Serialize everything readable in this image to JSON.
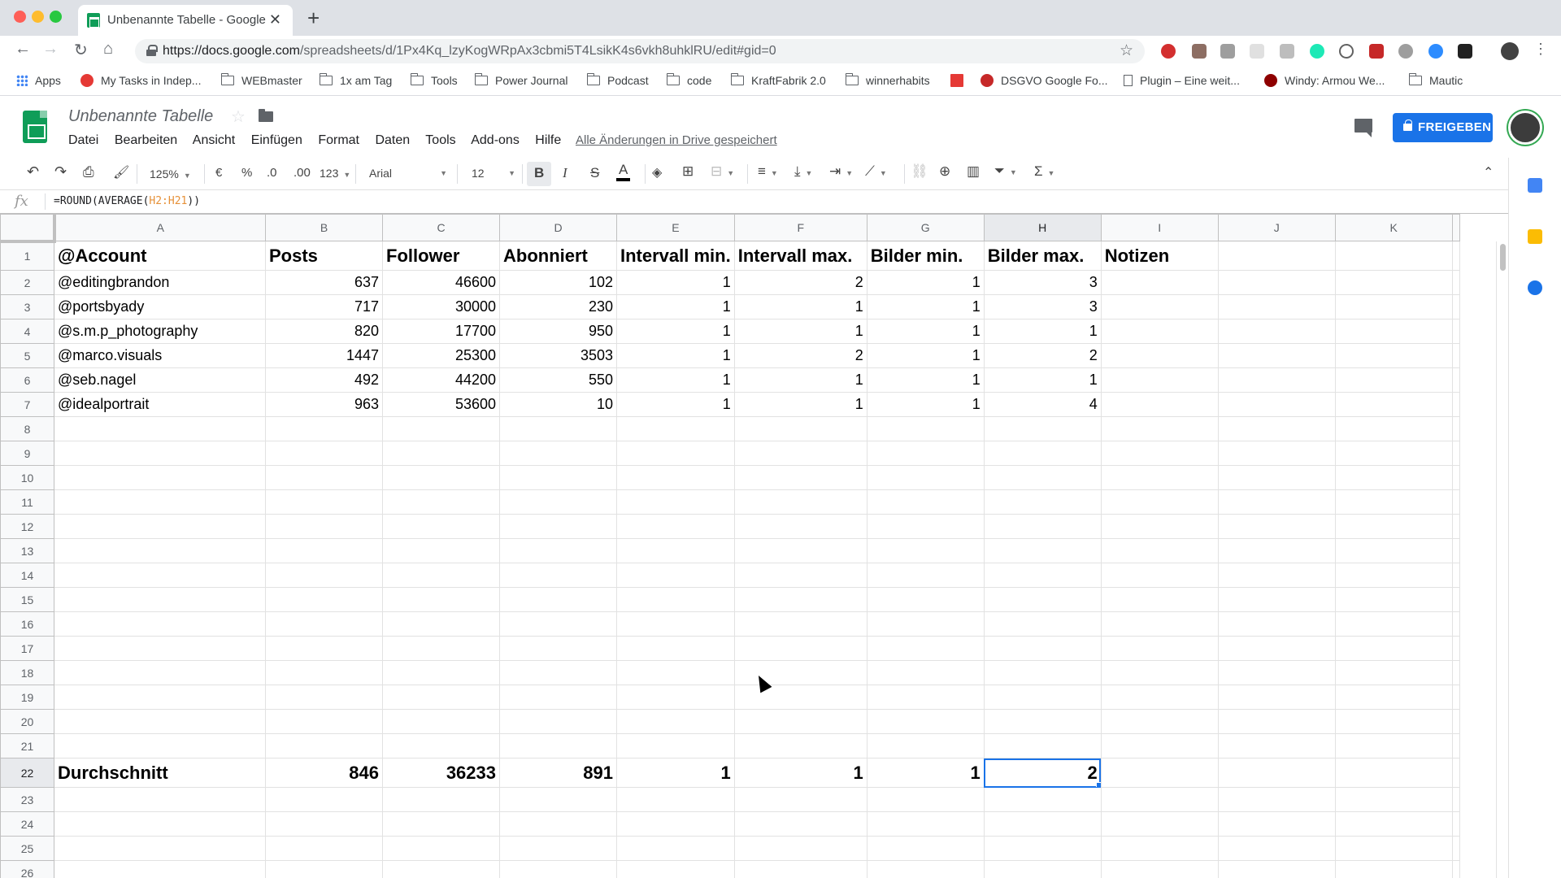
{
  "browser": {
    "tab_title": "Unbenannte Tabelle - Google T",
    "tab_close": "✕",
    "new_tab": "+",
    "url_host": "https://docs.google.com",
    "url_path": "/spreadsheets/d/1Px4Kq_lzyKogWRpAx3cbmi5T4LsikK4s6vkh8uhklRU/edit#gid=0",
    "bookmarks": [
      {
        "label": "Apps",
        "icon": "apps-grid-icon"
      },
      {
        "label": "My Tasks in Indep...",
        "icon": "tasks-icon"
      },
      {
        "label": "WEBmaster",
        "icon": "folder-icon"
      },
      {
        "label": "1x am Tag",
        "icon": "folder-icon"
      },
      {
        "label": "Tools",
        "icon": "folder-icon"
      },
      {
        "label": "Power Journal",
        "icon": "folder-icon"
      },
      {
        "label": "Podcast",
        "icon": "folder-icon"
      },
      {
        "label": "code",
        "icon": "folder-icon"
      },
      {
        "label": "KraftFabrik 2.0",
        "icon": "folder-icon"
      },
      {
        "label": "winnerhabits",
        "icon": "folder-icon"
      },
      {
        "label": "DSGVO Google Fo...",
        "icon": "dsgvo-icon"
      },
      {
        "label": "Plugin – Eine weit...",
        "icon": "page-icon"
      },
      {
        "label": "Windy: Armou We...",
        "icon": "windy-icon"
      },
      {
        "label": "Mautic",
        "icon": "folder-icon"
      }
    ]
  },
  "doc": {
    "title": "Unbenannte Tabelle",
    "menus": [
      "Datei",
      "Bearbeiten",
      "Ansicht",
      "Einfügen",
      "Format",
      "Daten",
      "Tools",
      "Add-ons",
      "Hilfe"
    ],
    "saved_status": "Alle Änderungen in Drive gespeichert",
    "share_label": "FREIGEBEN"
  },
  "toolbar": {
    "zoom": "125%",
    "currency": "€",
    "percent": "%",
    "dec_less": ".0",
    "dec_more": ".00",
    "more_formats": "123",
    "font": "Arial",
    "font_size": "12",
    "bold": "B",
    "italic": "I",
    "strike": "S",
    "text_color": "A",
    "functions": "Σ"
  },
  "formula_bar": {
    "fx": "fx",
    "prefix": "=ROUND(AVERAGE(",
    "ref": "H2:H21",
    "suffix": "))"
  },
  "grid": {
    "columns": [
      "A",
      "B",
      "C",
      "D",
      "E",
      "F",
      "G",
      "H",
      "I",
      "J",
      "K"
    ],
    "selected_column": "H",
    "selected_row": 22,
    "header_row": [
      "@Account",
      "Posts",
      "Follower",
      "Abonniert",
      "Intervall min.",
      "Intervall max.",
      "Bilder min.",
      "Bilder max.",
      "Notizen",
      "",
      ""
    ],
    "data_rows": [
      [
        "@editingbrandon",
        "637",
        "46600",
        "102",
        "1",
        "2",
        "1",
        "3",
        "",
        "",
        ""
      ],
      [
        "@portsbyady",
        "717",
        "30000",
        "230",
        "1",
        "1",
        "1",
        "3",
        "",
        "",
        ""
      ],
      [
        "@s.m.p_photography",
        "820",
        "17700",
        "950",
        "1",
        "1",
        "1",
        "1",
        "",
        "",
        ""
      ],
      [
        "@marco.visuals",
        "1447",
        "25300",
        "3503",
        "1",
        "2",
        "1",
        "2",
        "",
        "",
        ""
      ],
      [
        "@seb.nagel",
        "492",
        "44200",
        "550",
        "1",
        "1",
        "1",
        "1",
        "",
        "",
        ""
      ],
      [
        "@idealportrait",
        "963",
        "53600",
        "10",
        "1",
        "1",
        "1",
        "4",
        "",
        "",
        ""
      ]
    ],
    "average_row": [
      "Durchschnitt",
      "846",
      "36233",
      "891",
      "1",
      "1",
      "1",
      "2",
      "",
      "",
      ""
    ],
    "row_numbers": [
      "1",
      "2",
      "3",
      "4",
      "5",
      "6",
      "7",
      "8",
      "9",
      "10",
      "11",
      "12",
      "13",
      "14",
      "15",
      "16",
      "17",
      "18",
      "19",
      "20",
      "21",
      "22",
      "23",
      "24",
      "25",
      "26"
    ]
  },
  "colors": {
    "accent": "#1a73e8",
    "sheets_green": "#0f9d58",
    "formula_ref": "#e69138"
  }
}
